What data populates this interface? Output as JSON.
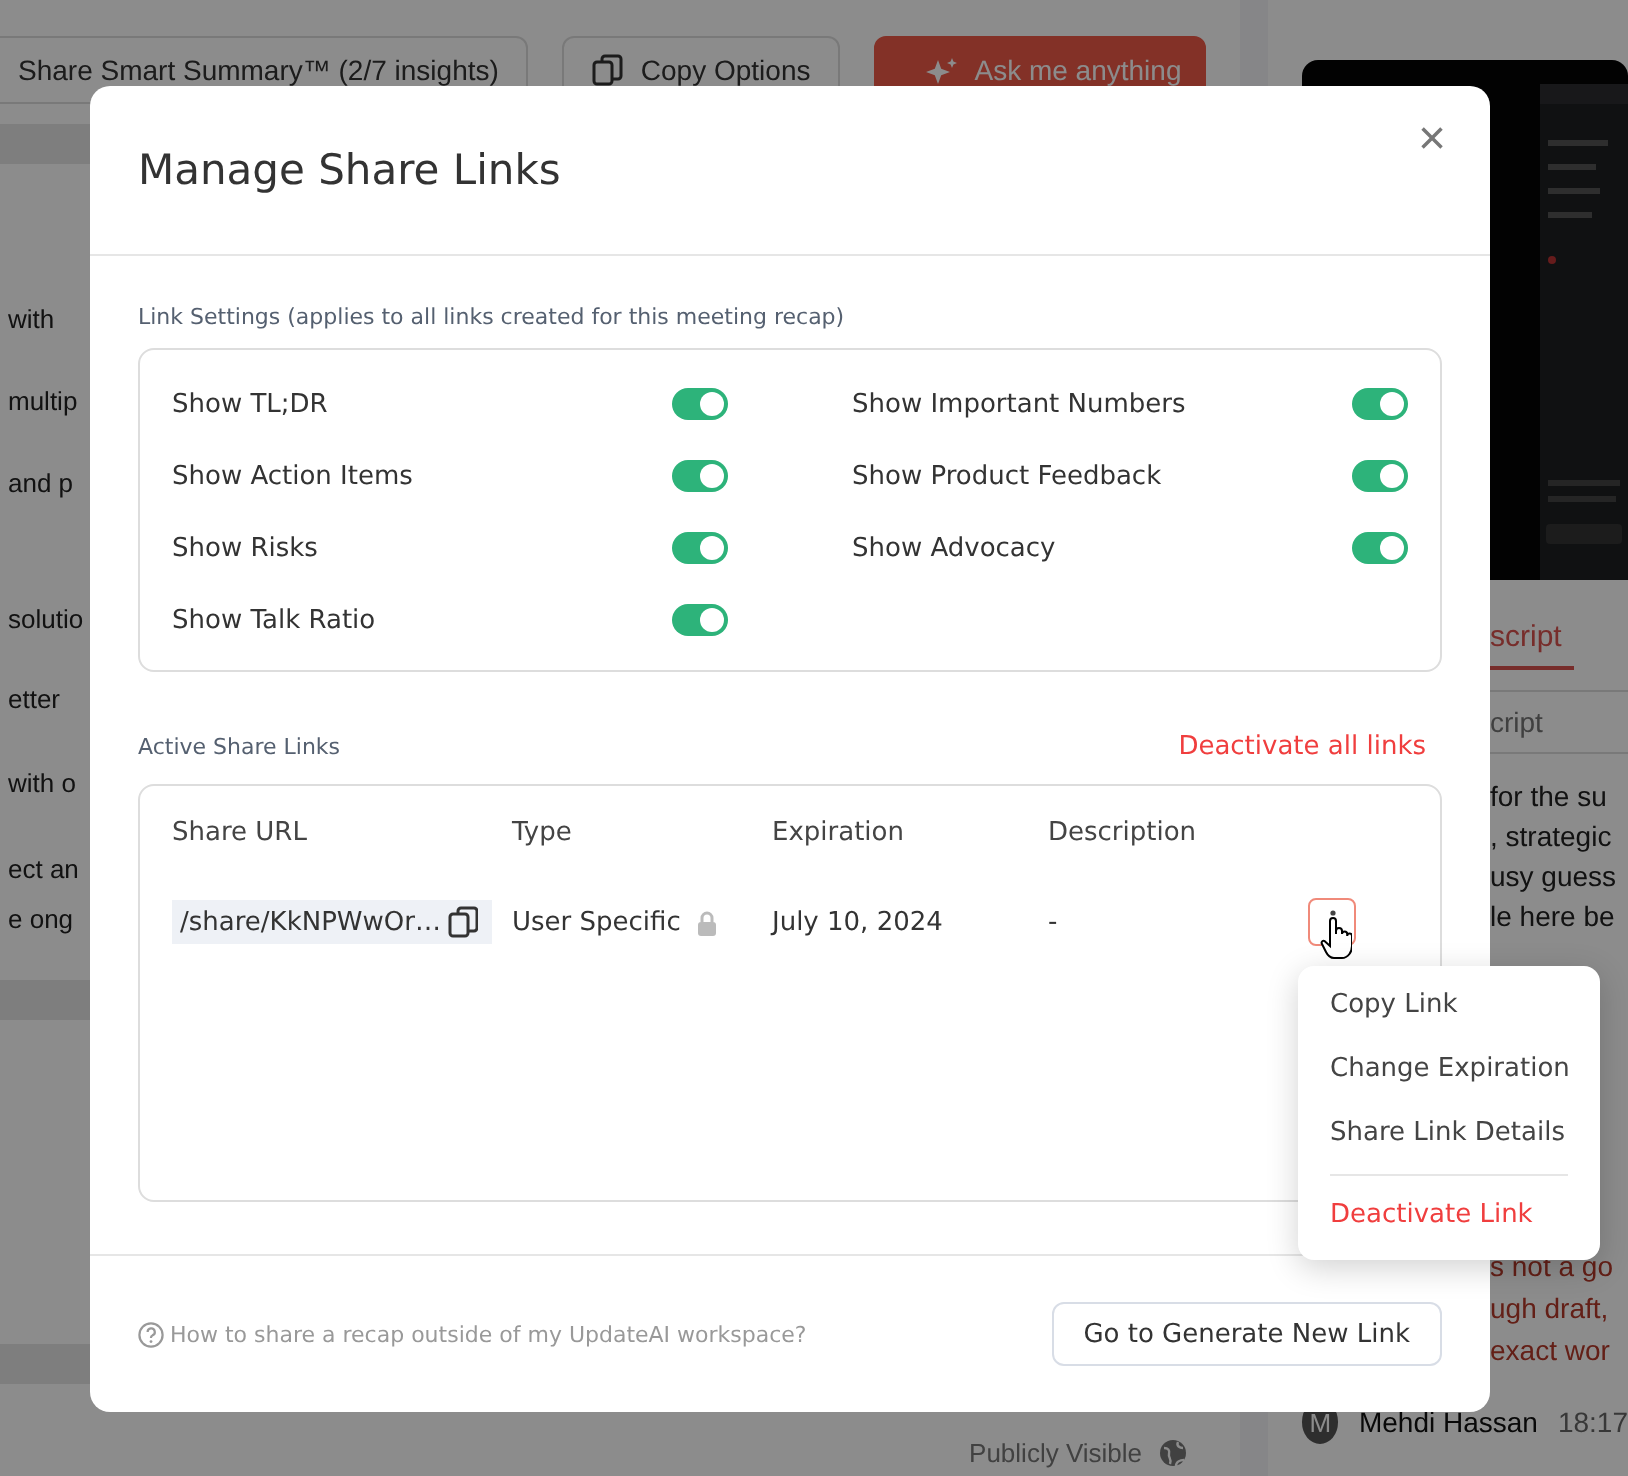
{
  "background": {
    "toolbar": [
      {
        "label": "Share Smart Summary™ (2/7 insights)",
        "kind": "plain"
      },
      {
        "label": "Copy Options",
        "kind": "copy"
      },
      {
        "label": "Ask me anything",
        "kind": "primary"
      }
    ],
    "summary_lines": [
      "with",
      "multip",
      "and p",
      "solutio",
      "etter",
      "with o",
      "ect an",
      "e ong"
    ],
    "status": "Publicly Visible",
    "transcript_tab": "script",
    "transcript_search": {
      "placeholder": "cript"
    },
    "transcript_lines": [
      "for the su",
      ", strategic",
      "usy guess",
      "le here be"
    ],
    "highlight_lines": [
      "s not a go",
      "ugh draft,",
      "exact wor"
    ],
    "speaker": {
      "avatar": "M",
      "name": "Mehdi Hassan",
      "time": "18:17"
    }
  },
  "dialog": {
    "title": "Manage Share Links",
    "close": "×",
    "settings_label": "Link Settings (applies to all links created for this meeting recap)",
    "settings": [
      [
        {
          "label": "Show TL;DR",
          "on": true
        },
        {
          "label": "Show Action Items",
          "on": true
        },
        {
          "label": "Show Risks",
          "on": true
        },
        {
          "label": "Show Talk Ratio",
          "on": true
        }
      ],
      [
        {
          "label": "Show Important Numbers",
          "on": true
        },
        {
          "label": "Show Product Feedback",
          "on": true
        },
        {
          "label": "Show Advocacy",
          "on": true
        }
      ]
    ],
    "links_label": "Active Share Links",
    "deactivate_all": "Deactivate all links",
    "columns": [
      "Share URL",
      "Type",
      "Expiration",
      "Description"
    ],
    "rows": [
      {
        "url": "/share/KkNPWwOr…",
        "type": "User Specific",
        "locked": true,
        "expiration": "July 10, 2024",
        "description": "-",
        "menu_open": true
      }
    ],
    "menu": [
      {
        "label": "Copy Link",
        "kind": "normal"
      },
      {
        "label": "Change Expiration",
        "kind": "normal"
      },
      {
        "label": "Share Link Details",
        "kind": "normal"
      },
      {
        "label": "Deactivate Link",
        "kind": "danger"
      }
    ],
    "help": "How to share a recap outside of my UpdateAI workspace?",
    "primary_action": "Go to Generate New Link"
  }
}
